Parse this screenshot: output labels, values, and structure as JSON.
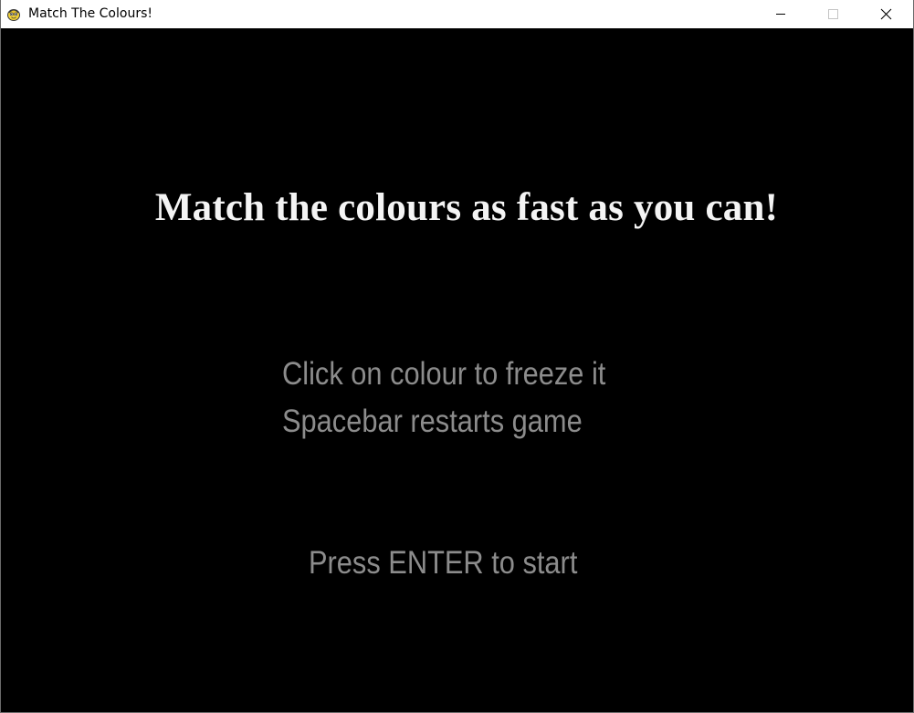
{
  "window": {
    "title": "Match The Colours!",
    "icon": "python-snake-icon",
    "controls": {
      "minimize": "minimize-icon",
      "maximize": "maximize-icon",
      "close": "close-icon"
    }
  },
  "game": {
    "background_color": "#000000",
    "headline": "Match the colours as fast as you can!",
    "headline_color": "#f4f4f4",
    "instructions": [
      "Click on colour to freeze it",
      "Spacebar restarts game"
    ],
    "start_prompt": "Press ENTER to start",
    "instruction_color": "#8c8c8c"
  }
}
